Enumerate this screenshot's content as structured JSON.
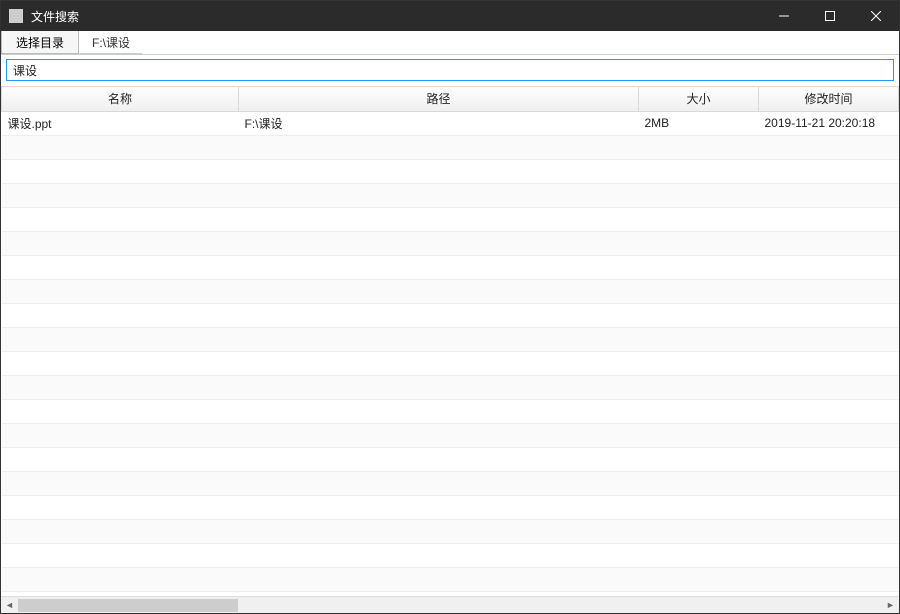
{
  "titlebar": {
    "title": "文件搜索"
  },
  "toolbar": {
    "select_dir_label": "选择目录",
    "current_path": "F:\\课设"
  },
  "search": {
    "value": "课设"
  },
  "table": {
    "headers": {
      "name": "名称",
      "path": "路径",
      "size": "大小",
      "modified": "修改时间"
    },
    "rows": [
      {
        "name": "课设.ppt",
        "path": "F:\\课设",
        "size": "2MB",
        "modified": "2019-11-21 20:20:18"
      }
    ],
    "empty_row_count": 19
  }
}
